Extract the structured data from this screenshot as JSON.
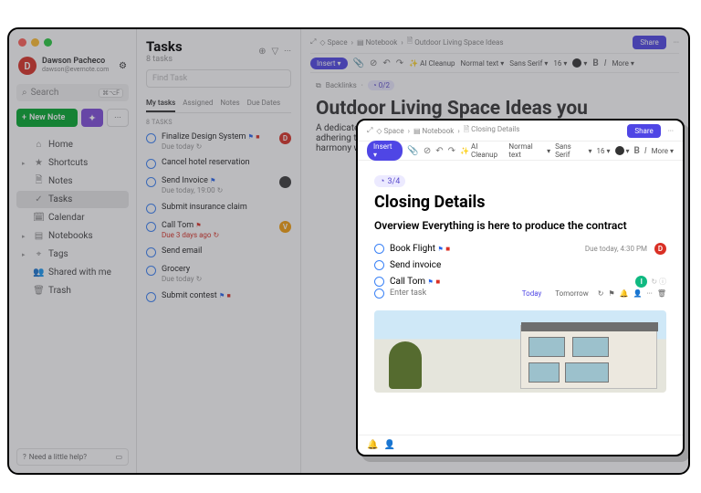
{
  "bg": {
    "user": {
      "initial": "D",
      "name": "Dawson Pacheco",
      "email": "dawson@evernote.com"
    },
    "search_placeholder": "Search",
    "search_kbd": "⌘⌥F",
    "newnote": "New Note",
    "nav": [
      "Home",
      "Shortcuts",
      "Notes",
      "Tasks",
      "Calendar",
      "Notebooks",
      "Tags",
      "Shared with me",
      "Trash"
    ],
    "help": "Need a little help?",
    "tasks": {
      "title": "Tasks",
      "count": "8 tasks",
      "find_placeholder": "Find Task",
      "tabs": [
        "My tasks",
        "Assigned",
        "Notes",
        "Due Dates"
      ],
      "section": "8 TASKS",
      "items": [
        {
          "title": "Finalize Design System",
          "meta": "Due today",
          "flag": "blue",
          "red": true,
          "badge": "D",
          "badge_color": "red"
        },
        {
          "title": "Cancel hotel reservation"
        },
        {
          "title": "Send Invoice",
          "meta": "Due today, 19:00",
          "flag": "blue",
          "badge": "",
          "badge_color": "dk"
        },
        {
          "title": "Submit insurance claim"
        },
        {
          "title": "Call Tom",
          "meta": "Due 3 days ago",
          "flag": "red",
          "due_red": true,
          "badge": "V",
          "badge_color": "y"
        },
        {
          "title": "Send email"
        },
        {
          "title": "Grocery",
          "meta": "Due today"
        },
        {
          "title": "Submit contest",
          "flag": "blue",
          "red": true
        }
      ]
    },
    "note": {
      "crumb": [
        "Space",
        "Notebook",
        "Outdoor Living Space Ideas"
      ],
      "share": "Share",
      "toolbar": {
        "insert": "Insert",
        "cleanup": "AI Cleanup",
        "style": "Normal text",
        "font": "Sans Serif",
        "size": "16",
        "more": "More"
      },
      "backlinks_label": "Backlinks",
      "backlinks_count": "0/2",
      "title": "Outdoor Living Space Ideas you",
      "body": "A dedicated grilling area with a built-in barbecue keeps adhering to outdoor cooking principles sustaining aesthetic harmony with the bedroom arrangements"
    }
  },
  "fg": {
    "crumb": [
      "Space",
      "Notebook",
      "Closing Details"
    ],
    "share": "Share",
    "toolbar": {
      "insert": "Insert",
      "cleanup": "AI Cleanup",
      "style": "Normal text",
      "font": "Sans Serif",
      "size": "16",
      "more": "More"
    },
    "progress": "3/4",
    "title": "Closing Details",
    "subtitle": "Overview Everything is here to produce the contract",
    "tasks": [
      {
        "title": "Book Flight",
        "flag": "blue",
        "red": true,
        "meta": "Due today, 4:30 PM",
        "badge": "D",
        "badge_color": "red"
      },
      {
        "title": "Send invoice"
      },
      {
        "title": "Call Tom",
        "flag": "blue",
        "red": true,
        "badge": "I",
        "badge_color": "green"
      }
    ],
    "enter_placeholder": "Enter task",
    "chips": [
      "Today",
      "Tomorrow"
    ]
  }
}
